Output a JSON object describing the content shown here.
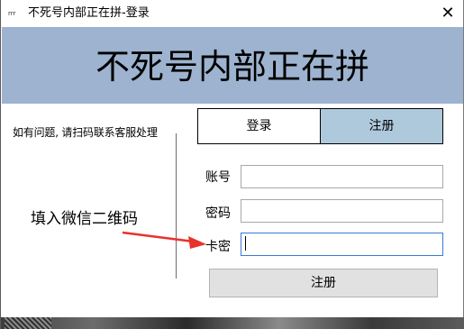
{
  "titlebar": {
    "icon_text": "rrr",
    "title": "不死号内部正在拼-登录",
    "close_label": "✕"
  },
  "banner": {
    "title": "不死号内部正在拼"
  },
  "left_panel": {
    "help_text": "如有问题, 请扫码联系客服处理",
    "qr_placeholder": "填入微信二维码"
  },
  "tabs": {
    "login_label": "登录",
    "register_label": "注册",
    "active": "register"
  },
  "form": {
    "account_label": "账号",
    "account_value": "",
    "password_label": "密码",
    "password_value": "",
    "card_label": "卡密",
    "card_value": "",
    "submit_label": "注册"
  },
  "colors": {
    "banner_bg": "#9db3cf",
    "active_tab_bg": "#afc9dc",
    "arrow": "#e8322c"
  }
}
